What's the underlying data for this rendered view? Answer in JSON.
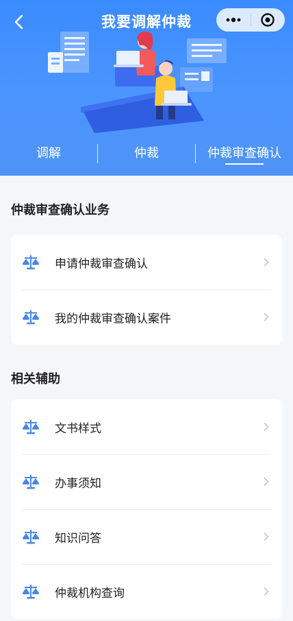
{
  "nav": {
    "title": "我要调解仲裁"
  },
  "tabs": [
    {
      "label": "调解",
      "active": false
    },
    {
      "label": "仲裁",
      "active": false
    },
    {
      "label": "仲裁审查确认",
      "active": true
    }
  ],
  "sections": [
    {
      "title": "仲裁审查确认业务",
      "items": [
        {
          "label": "申请仲裁审查确认",
          "icon": "scale-icon"
        },
        {
          "label": "我的仲裁审查确认案件",
          "icon": "scale-icon"
        }
      ]
    },
    {
      "title": "相关辅助",
      "items": [
        {
          "label": "文书样式",
          "icon": "scale-icon"
        },
        {
          "label": "办事须知",
          "icon": "scale-icon"
        },
        {
          "label": "知识问答",
          "icon": "scale-icon"
        },
        {
          "label": "仲裁机构查询",
          "icon": "scale-icon"
        }
      ]
    }
  ],
  "colors": {
    "header_blue": "#3a8bff",
    "icon_blue": "#4a86e8",
    "background": "#f5f6f8"
  }
}
